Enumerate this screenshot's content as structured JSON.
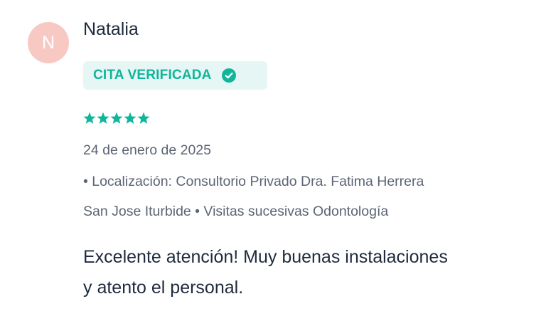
{
  "reviewer": {
    "initial": "N",
    "name": "Natalia"
  },
  "badge": {
    "label": "CITA VERIFICADA",
    "icon": "check-circle-icon"
  },
  "rating": {
    "stars": 5,
    "max": 5
  },
  "review": {
    "date": "24 de enero de 2025",
    "location_line": "• Localización: Consultorio Privado Dra. Fatima Herrera",
    "meta_line2": "San Jose Iturbide • Visitas sucesivas Odontología",
    "text_line1": "Excelente atención! Muy buenas instalaciones",
    "text_line2": "y atento el personal."
  },
  "colors": {
    "accent": "#10b59a",
    "badge_bg": "#e6f6f4",
    "avatar_bg": "#f7c9c2",
    "text_primary": "#1f2a3d",
    "text_secondary": "#5b6575"
  }
}
